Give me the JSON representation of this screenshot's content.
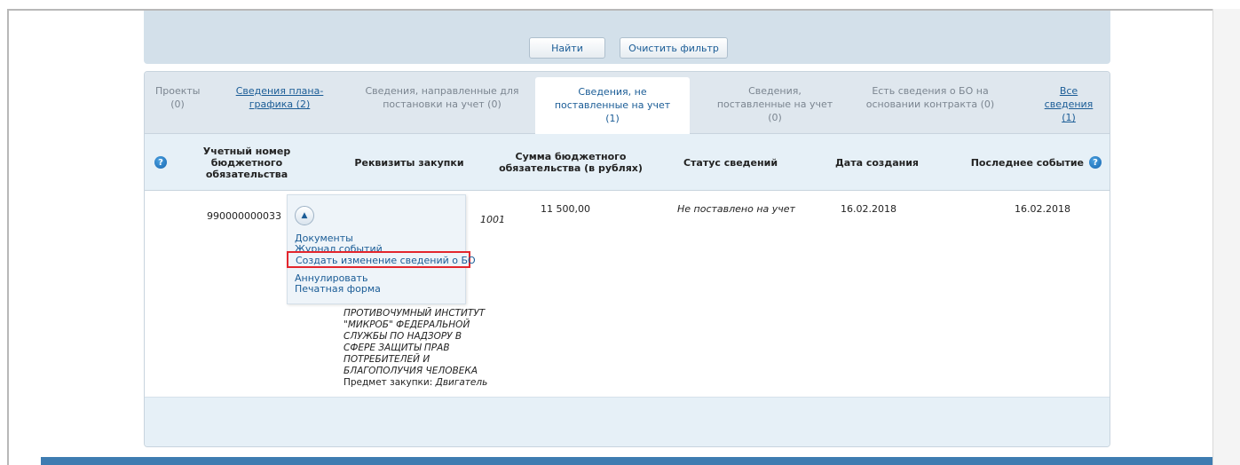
{
  "filter": {
    "find_label": "Найти",
    "clear_label": "Очистить фильтр"
  },
  "tabs": [
    {
      "line1": "Проекты",
      "line2": "(0)",
      "line3": ""
    },
    {
      "line1": "Сведения плана-",
      "line2": "графика (2)",
      "line3": ""
    },
    {
      "line1": "Сведения, направленные для",
      "line2": "постановки на учет (0)",
      "line3": ""
    },
    {
      "line1": "Сведения, не",
      "line2": "поставленные на учет",
      "line3": "(1)"
    },
    {
      "line1": "Сведения,",
      "line2": "поставленные на учет",
      "line3": "(0)"
    },
    {
      "line1": "Есть сведения о БО на",
      "line2": "основании контракта (0)",
      "line3": ""
    },
    {
      "line1": "Все",
      "line2": "сведения",
      "line3": "(1)"
    }
  ],
  "columns": {
    "help": "?",
    "c1": [
      "Учетный номер",
      "бюджетного",
      "обязательства"
    ],
    "c2": "Реквизиты закупки",
    "c3": [
      "Сумма бюджетного",
      "обязательства (в рублях)"
    ],
    "c4": "Статус сведений",
    "c5": "Дата создания",
    "c6": "Последнее событие"
  },
  "row": {
    "number": "990000000033",
    "partial_text": "1001",
    "amount": "11 500,00",
    "status": "Не поставлено на учет",
    "created": "16.02.2018",
    "last_event": "16.02.2018",
    "org_lines": [
      "ПРОТИВОЧУМНЫЙ ИНСТИТУТ",
      "\"МИКРОБ\" ФЕДЕРАЛЬНОЙ",
      "СЛУЖБЫ ПО НАДЗОРУ В",
      "СФЕРЕ ЗАЩИТЫ ПРАВ",
      "ПОТРЕБИТЕЛЕЙ И",
      "БЛАГОПОЛУЧИЯ ЧЕЛОВЕКА"
    ],
    "subject_label": "Предмет закупки:",
    "subject_value": "Двигатель"
  },
  "menu": {
    "documents": "Документы",
    "events": "Журнал событий",
    "create_change": "Создать изменение сведений о БО",
    "cancel": "Аннулировать",
    "print": "Печатная форма"
  },
  "colors": {
    "accent": "#1a5c96",
    "highlight": "#e3262d",
    "header_bg": "#d3e0ea"
  }
}
